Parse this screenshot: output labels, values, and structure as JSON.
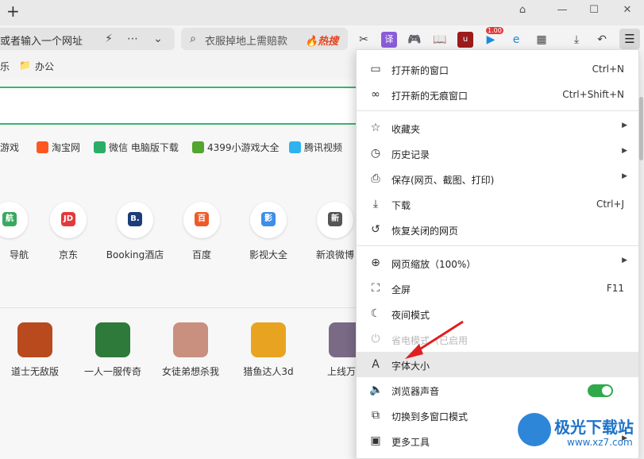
{
  "browser": {
    "new_tab": "+",
    "window_controls": {
      "pin": "⌂",
      "minimize": "—",
      "maximize": "☐",
      "close": "✕"
    },
    "address_placeholder": "或者输入一个网址",
    "search_placeholder": "衣服掉地上需赔款",
    "hot_search": "🔥热搜",
    "ext_badge": "1.00"
  },
  "bookmarks": [
    {
      "label": "乐"
    },
    {
      "label": "办公"
    }
  ],
  "page": {
    "quick_links": [
      {
        "label": "游戏",
        "color": "#ffffff"
      },
      {
        "label": "淘宝网",
        "color": "#ff5722"
      },
      {
        "label": "微信 电脑版下载",
        "color": "#2aae67"
      },
      {
        "label": "4399小游戏大全",
        "color": "#52a52e"
      },
      {
        "label": "腾讯视频",
        "color": "#2eb3f0"
      }
    ],
    "sites": [
      {
        "name": "导航",
        "logo": "航",
        "color": "#3aa95f"
      },
      {
        "name": "京东",
        "logo": "JD",
        "color": "#e4393c"
      },
      {
        "name": "Booking酒店",
        "logo": "B.",
        "color": "#1b3d7a"
      },
      {
        "name": "百度",
        "logo": "百",
        "color": "#f05a28"
      },
      {
        "name": "影视大全",
        "logo": "影",
        "color": "#3c8ee8"
      },
      {
        "name": "新浪微博",
        "logo": "新",
        "color": "#555555"
      }
    ],
    "games": [
      {
        "name": "道士无敌版",
        "color": "#b84a1e"
      },
      {
        "name": "一人一服传奇",
        "color": "#2d7a3a"
      },
      {
        "name": "女徒弟想杀我",
        "color": "#c98f7f"
      },
      {
        "name": "猎鱼达人3d",
        "color": "#e8a421"
      },
      {
        "name": "上线万年",
        "color": "#7a6a86"
      }
    ]
  },
  "menu": {
    "items": [
      {
        "icon": "▭",
        "label": "打开新的窗口",
        "shortcut": "Ctrl+N"
      },
      {
        "icon": "∞",
        "label": "打开新的无痕窗口",
        "shortcut": "Ctrl+Shift+N"
      },
      {
        "icon": "☆",
        "label": "收藏夹",
        "submenu": "▶"
      },
      {
        "icon": "◷",
        "label": "历史记录",
        "submenu": "▶"
      },
      {
        "icon": "⎙",
        "label": "保存(网页、截图、打印)",
        "submenu": "▶"
      },
      {
        "icon": "⤓",
        "label": "下载",
        "shortcut": "Ctrl+J"
      },
      {
        "icon": "↺",
        "label": "恢复关闭的网页"
      },
      {
        "icon": "⊕",
        "label": "网页缩放（100%）",
        "submenu": "▶"
      },
      {
        "icon": "⛶",
        "label": "全屏",
        "shortcut": "F11"
      },
      {
        "icon": "☾",
        "label": "夜间模式"
      },
      {
        "icon": "⏻",
        "label": "省电模式（已启用"
      },
      {
        "icon": "A",
        "label": "字体大小"
      },
      {
        "icon": "🔈",
        "label": "浏览器声音",
        "toggle_on": true
      },
      {
        "icon": "⧉",
        "label": "切换到多窗口模式"
      },
      {
        "icon": "▣",
        "label": "更多工具",
        "submenu": "▶"
      }
    ]
  },
  "watermark": {
    "title": "极光下载站",
    "url": "www.xz7.com"
  },
  "colors": {
    "accent_green": "#3bb56b",
    "toggle_green": "#2eaa4a",
    "arrow_red": "#e02020",
    "hot_red": "#e8421f"
  }
}
